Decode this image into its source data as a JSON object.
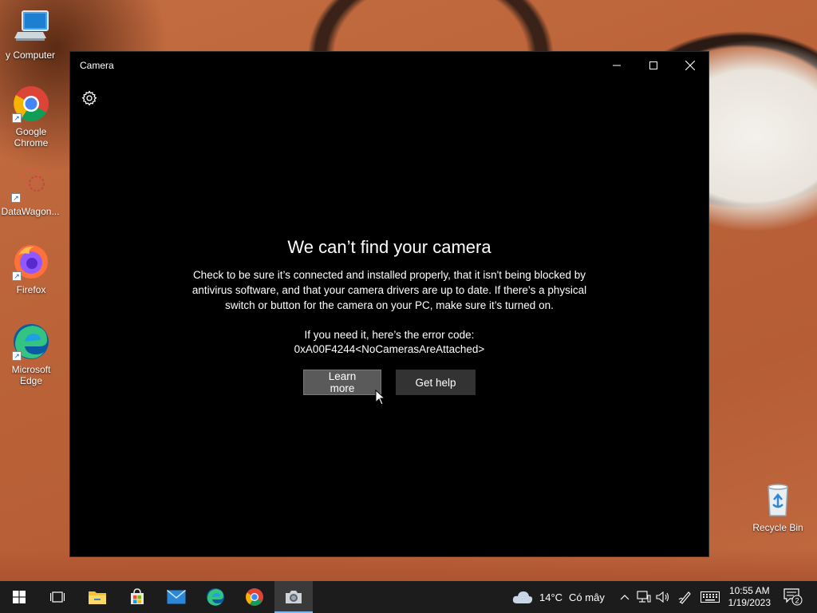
{
  "desktop": {
    "icons": [
      {
        "label": "y Computer",
        "icon": "computer-icon"
      },
      {
        "label": "Google Chrome",
        "icon": "chrome-icon"
      },
      {
        "label": "DataWagon...",
        "icon": "datawagon-icon"
      },
      {
        "label": "Firefox",
        "icon": "firefox-icon"
      },
      {
        "label": "Microsoft Edge",
        "icon": "edge-icon"
      },
      {
        "label": "Recycle Bin",
        "icon": "recycle-bin-icon"
      }
    ]
  },
  "window": {
    "title": "Camera",
    "heading": "We can’t find your camera",
    "body": "Check to be sure it’s connected and installed properly, that it isn't being blocked by antivirus software, and that your camera drivers are up to date. If there’s a physical switch or button for the camera on your PC, make sure it’s turned on.",
    "error_intro": "If you need it, here’s the error code:",
    "error_code": "0xA00F4244<NoCamerasAreAttached>",
    "learn_more_label": "Learn more",
    "get_help_label": "Get help"
  },
  "taskbar": {
    "weather_temp": "14°C",
    "weather_desc": "Có mây",
    "time": "10:55 AM",
    "date": "1/19/2023",
    "notification_count": "2",
    "accent": "#7fb7ef"
  }
}
